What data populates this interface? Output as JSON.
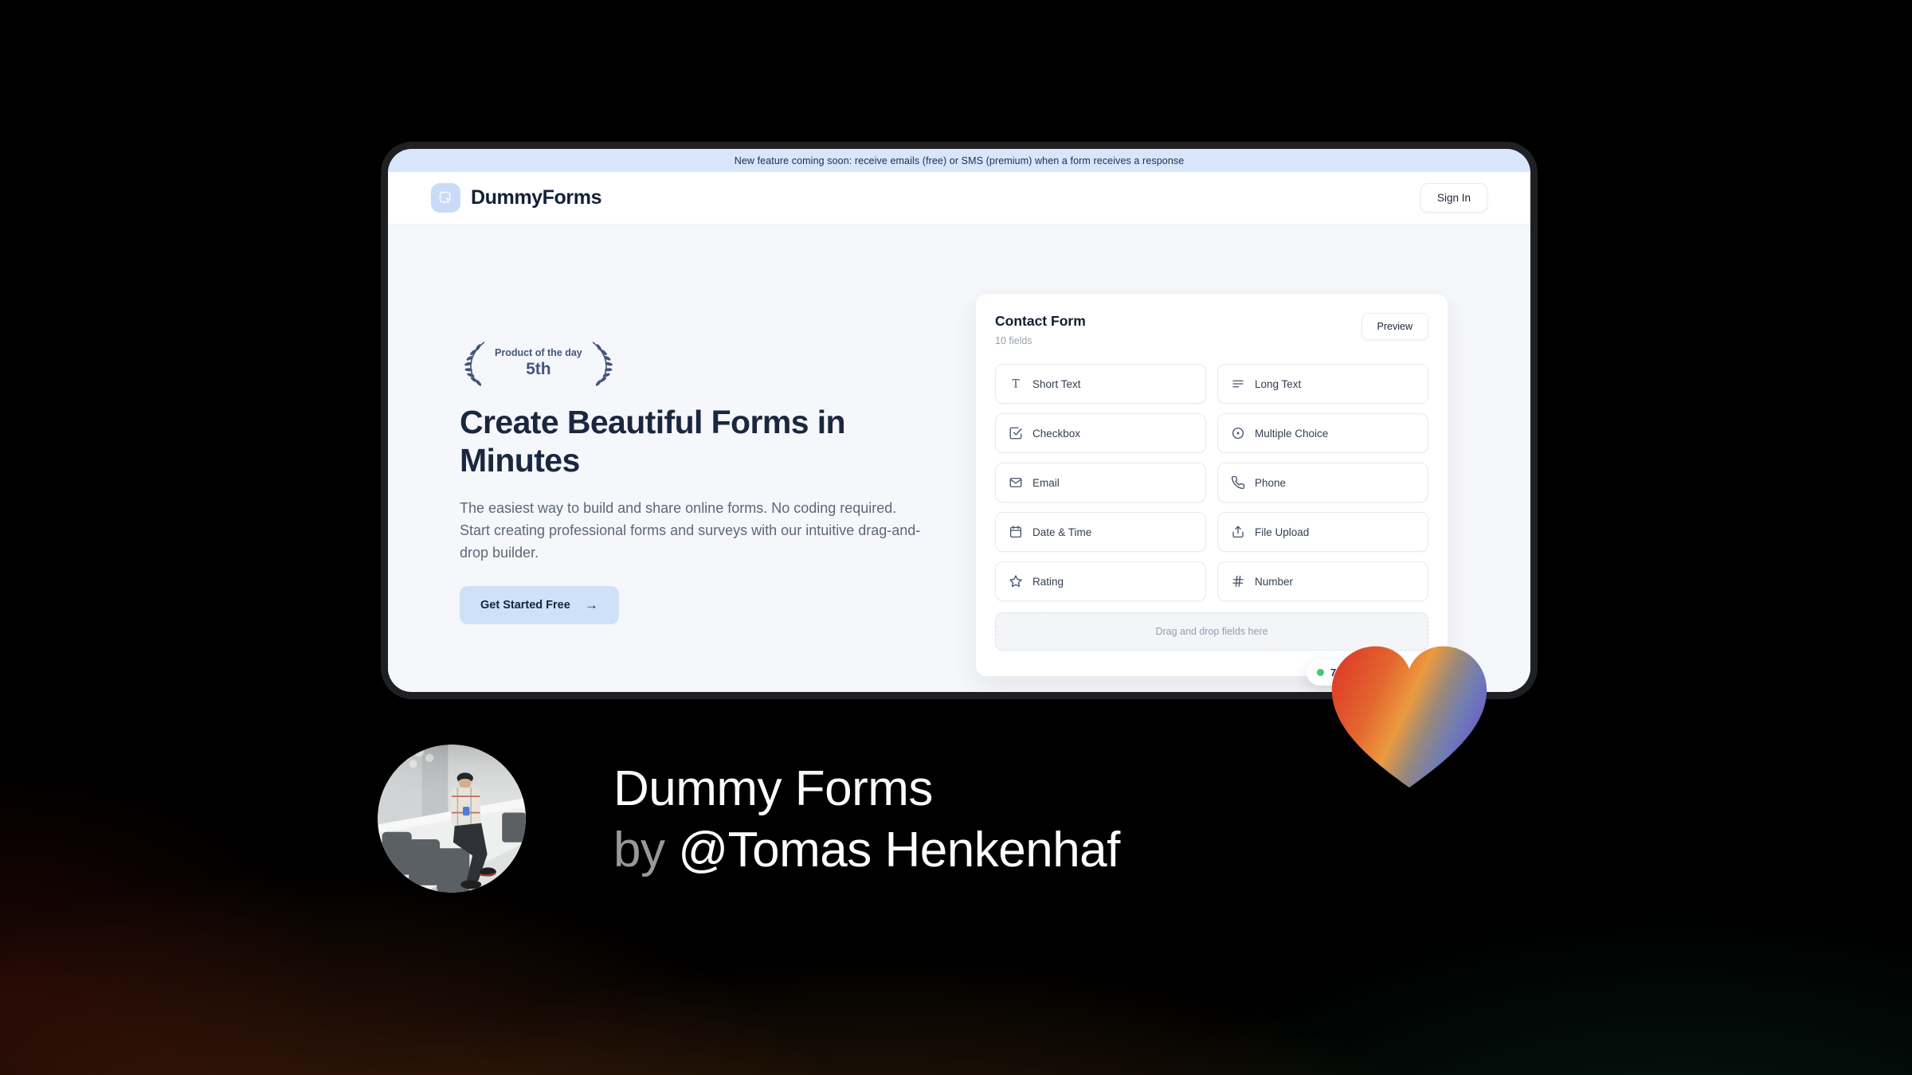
{
  "browser": {
    "banner": {
      "text": "New feature coming soon: receive emails (free) or SMS (premium) when a form receives a response",
      "bg": "#d9e5fb"
    },
    "header": {
      "brand": "DummyForms",
      "sign_in_label": "Sign In"
    },
    "hero": {
      "badge": {
        "line1": "Product of the day",
        "line2": "5th"
      },
      "title": "Create Beautiful Forms in Minutes",
      "description": "The easiest way to build and share online forms. No coding required. Start creating professional forms and surveys with our intuitive drag-and-drop builder.",
      "cta_label": "Get Started Free",
      "cta_arrow": "→"
    },
    "form_builder": {
      "title": "Contact Form",
      "subtitle": "10 fields",
      "preview_label": "Preview",
      "fields": [
        {
          "id": "short-text",
          "label": "Short Text",
          "icon": "text-icon"
        },
        {
          "id": "long-text",
          "label": "Long Text",
          "icon": "lines-icon"
        },
        {
          "id": "checkbox",
          "label": "Checkbox",
          "icon": "checkbox-icon"
        },
        {
          "id": "multiple-choice",
          "label": "Multiple Choice",
          "icon": "radio-icon"
        },
        {
          "id": "email",
          "label": "Email",
          "icon": "envelope-icon"
        },
        {
          "id": "phone",
          "label": "Phone",
          "icon": "phone-icon"
        },
        {
          "id": "date-time",
          "label": "Date & Time",
          "icon": "calendar-icon"
        },
        {
          "id": "file-upload",
          "label": "File Upload",
          "icon": "upload-icon"
        },
        {
          "id": "rating",
          "label": "Rating",
          "icon": "star-icon"
        },
        {
          "id": "number",
          "label": "Number",
          "icon": "hash-icon"
        }
      ],
      "dropzone_text": "Drag and drop fields here",
      "status_badge": {
        "dot_color": "#44c76f",
        "visible_text": "7"
      }
    }
  },
  "footer": {
    "title": "Dummy Forms",
    "byline_prefix": "by ",
    "byline_handle": "@Tomas Henkenhaf"
  },
  "colors": {
    "accent_light_blue": "#cfe1f9",
    "navy": "#1a2740",
    "laurel": "#44567d",
    "heart_red": "#dc3927",
    "heart_orange": "#eb9a3e",
    "heart_indigo": "#6d5cc6",
    "status_green": "#44c76f"
  }
}
